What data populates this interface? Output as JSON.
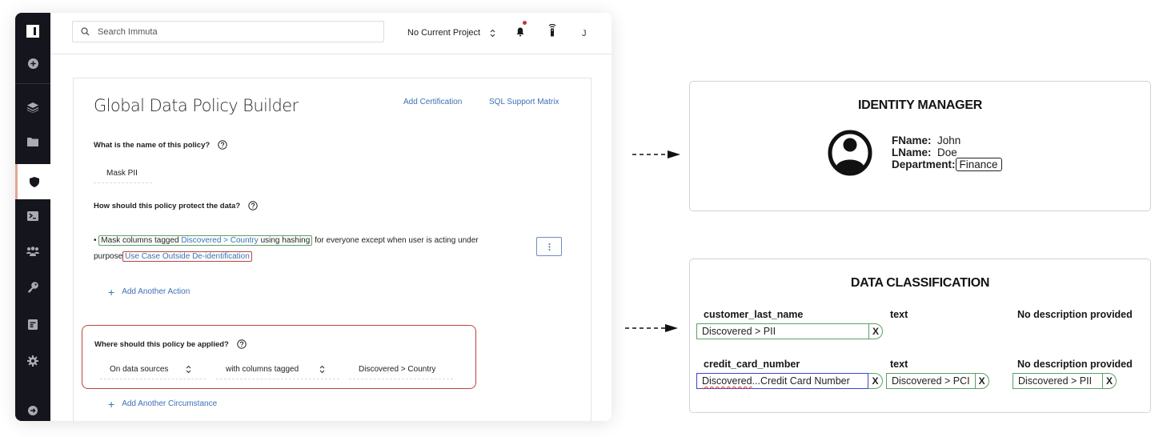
{
  "app": {
    "search": {
      "placeholder": "Search Immuta"
    },
    "topbar": {
      "project_label": "No Current Project",
      "user_initial": "J",
      "notification_dot_color": "#c4392f"
    },
    "sidebar": {
      "items": [
        {
          "name": "logo",
          "icon": "immuta-logo-icon",
          "active": false
        },
        {
          "name": "create",
          "icon": "plus-circle-icon",
          "active": false
        },
        {
          "name": "data-sources",
          "icon": "layers-icon",
          "active": false
        },
        {
          "name": "projects",
          "icon": "folder-icon",
          "active": false
        },
        {
          "name": "policies",
          "icon": "shield-icon",
          "active": true
        },
        {
          "name": "query-editor",
          "icon": "terminal-icon",
          "active": false
        },
        {
          "name": "people",
          "icon": "users-icon",
          "active": false
        },
        {
          "name": "governance",
          "icon": "key-icon",
          "active": false
        },
        {
          "name": "audit",
          "icon": "document-icon",
          "active": false
        },
        {
          "name": "settings",
          "icon": "gear-icon",
          "active": false
        },
        {
          "name": "expand",
          "icon": "arrow-right-circle-icon",
          "active": false
        }
      ],
      "active_accent_color": "#e3a696"
    },
    "panel": {
      "title": "Global Data Policy Builder",
      "links": {
        "add_certification": "Add Certification",
        "sql_support_matrix": "SQL Support Matrix"
      },
      "name_question": "What is the name of this policy?",
      "policy_name": "Mask PII",
      "protect_question": "How should this policy protect the data?",
      "action": {
        "bullet": "•",
        "prefix": "Mask columns tagged",
        "tag": "Discovered > Country",
        "method": "using hashing",
        "middle": "for everyone except when user is acting under purpose",
        "purpose": "Use Case Outside De-identification"
      },
      "add_action": "Add Another Action",
      "where_question": "Where should this policy be applied?",
      "where": {
        "scope": "On data sources",
        "condition": "with columns tagged",
        "tag": "Discovered > Country"
      },
      "add_circumstance": "Add Another Circumstance"
    }
  },
  "identity_manager": {
    "title": "IDENTITY MANAGER",
    "fields": [
      {
        "key": "FName:",
        "value": "John"
      },
      {
        "key": "LName:",
        "value": "Doe"
      },
      {
        "key": "Department:",
        "value": "Finance"
      }
    ]
  },
  "data_classification": {
    "title": "DATA CLASSIFICATION",
    "rows": [
      {
        "column": "customer_last_name",
        "type": "text",
        "description": "No description provided",
        "tags": [
          "Discovered > PII"
        ]
      },
      {
        "column": "credit_card_number",
        "type": "text",
        "description": "No description provided",
        "tags": [
          "Discovered ...Credit Card Number",
          "Discovered > PCI",
          "Discovered > PII"
        ]
      }
    ],
    "remove_label": "X"
  },
  "colors": {
    "green_highlight": "#5c9f66",
    "red_highlight": "#b8453a",
    "blue_highlight": "#3b45d6",
    "link_blue": "#3d6fb6",
    "sidebar_bg": "#15161d"
  }
}
